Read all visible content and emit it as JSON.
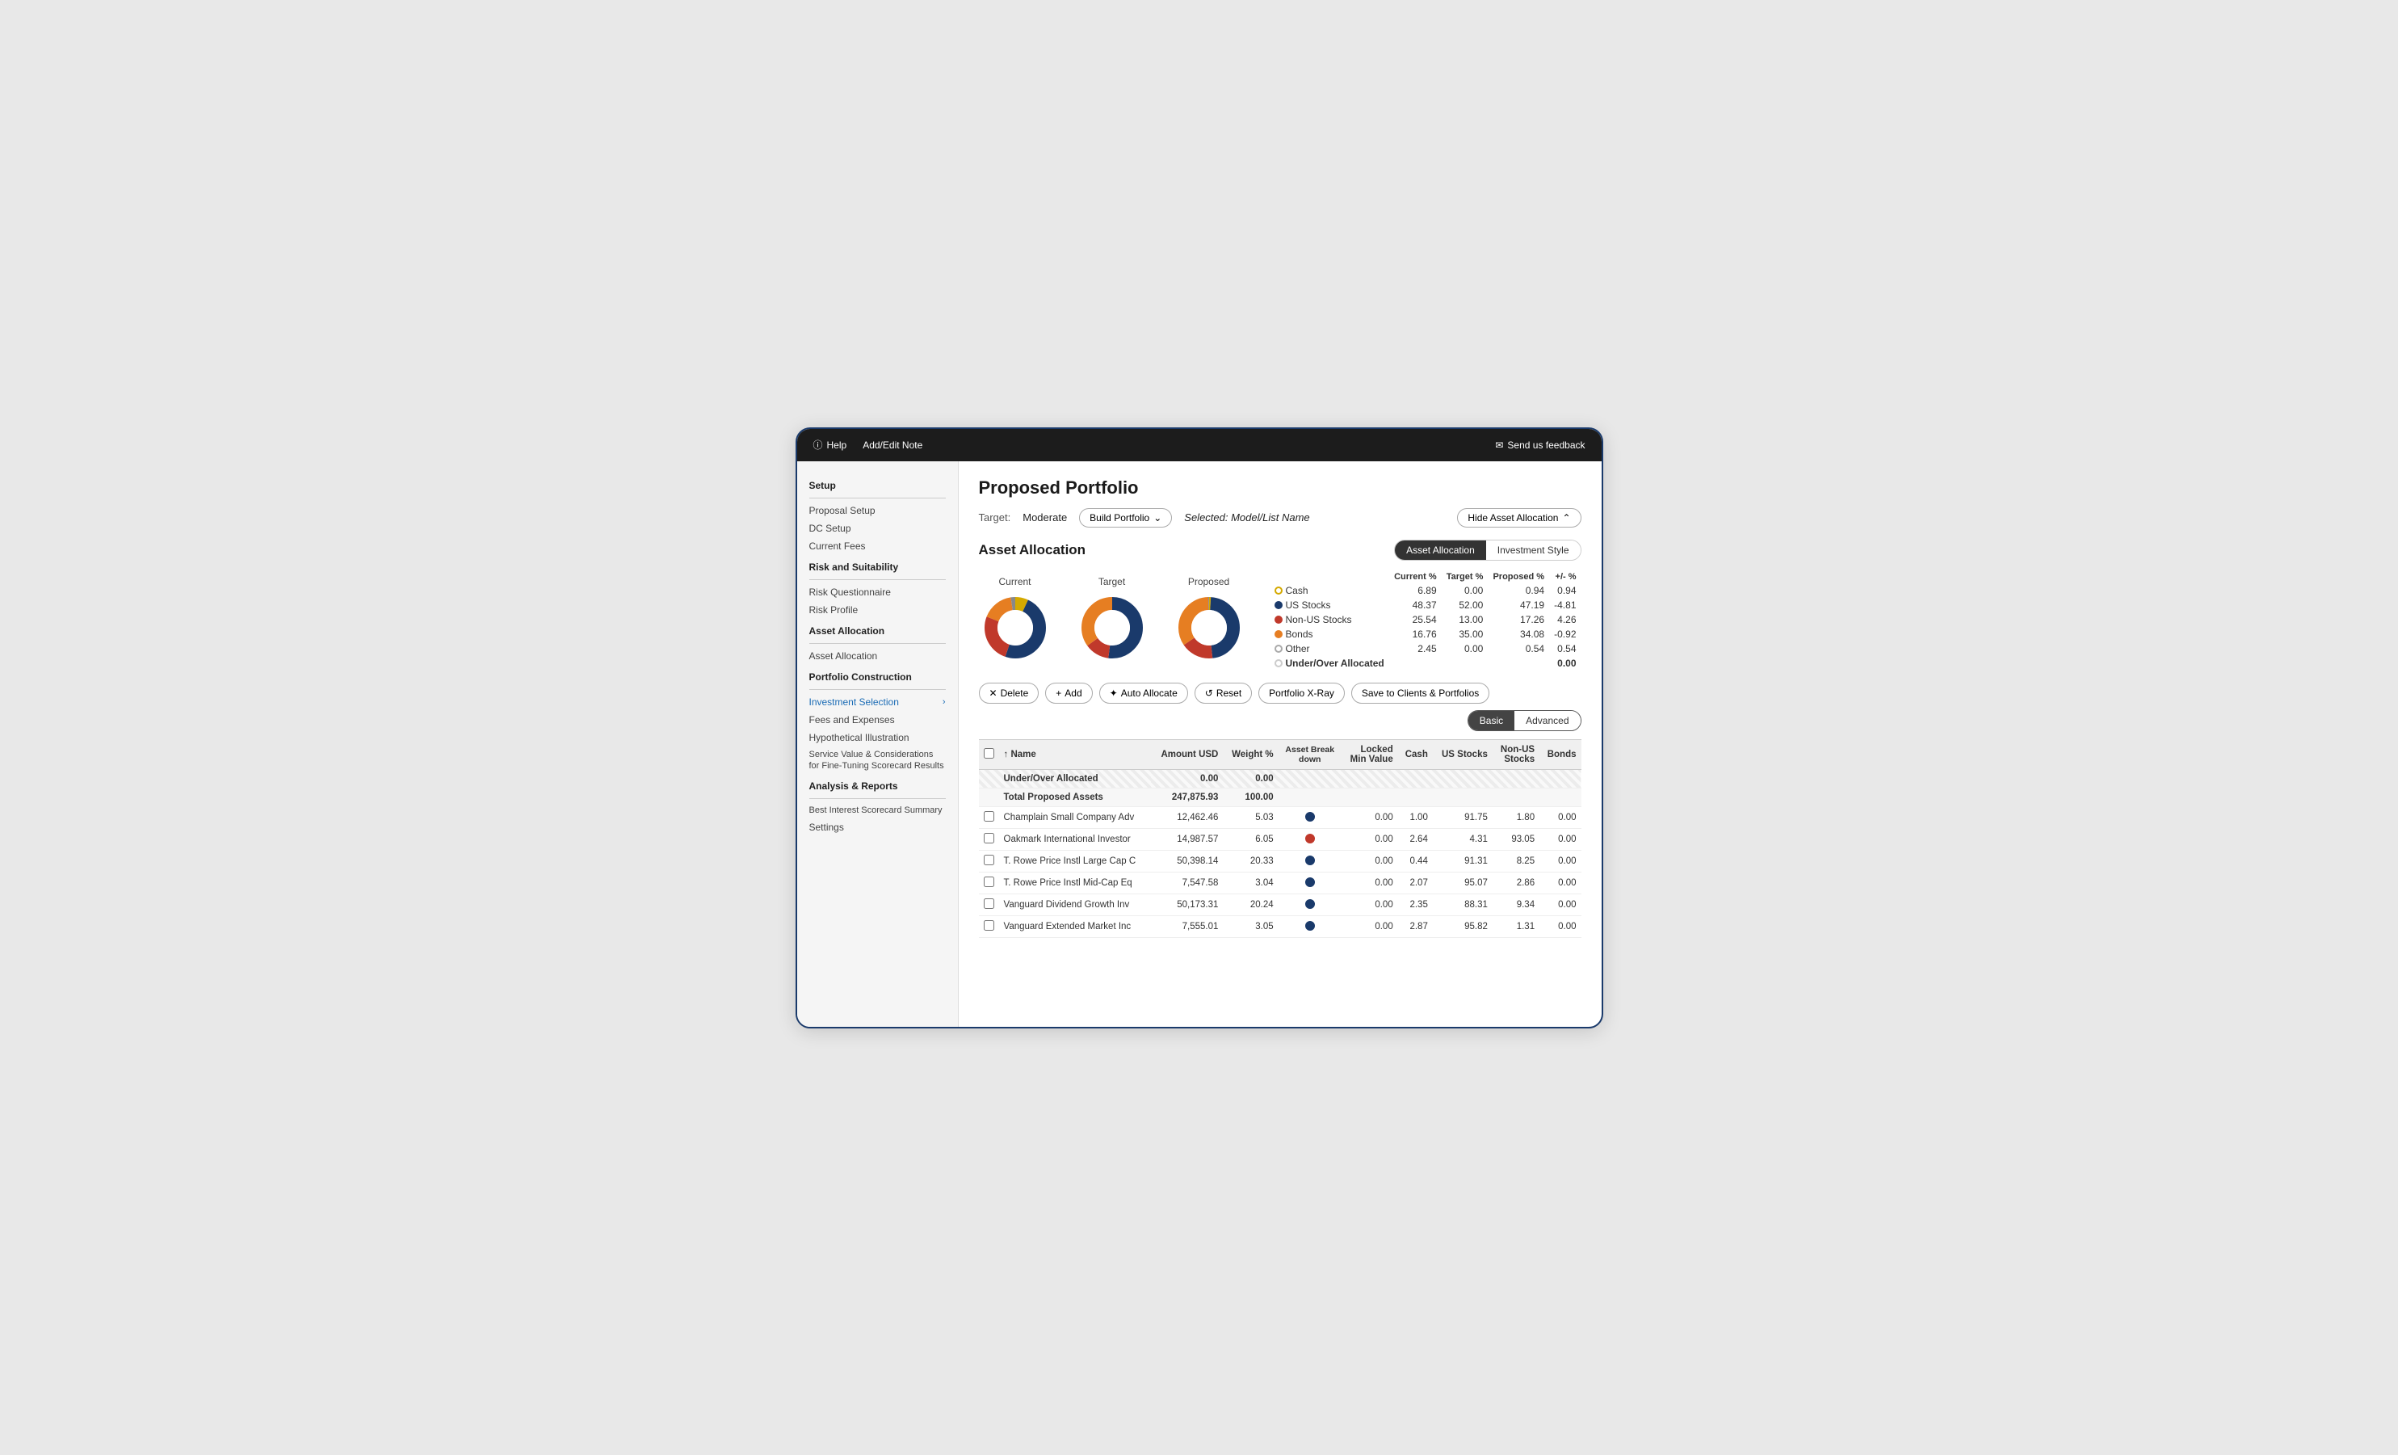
{
  "topbar": {
    "help_label": "Help",
    "add_edit_note_label": "Add/Edit Note",
    "feedback_label": "Send us feedback"
  },
  "sidebar": {
    "sections": [
      {
        "title": "Setup",
        "items": [
          {
            "label": "Proposal Setup",
            "active": false
          },
          {
            "label": "DC Setup",
            "active": false
          },
          {
            "label": "Current Fees",
            "active": false
          }
        ]
      },
      {
        "title": "Risk and Suitability",
        "items": [
          {
            "label": "Risk Questionnaire",
            "active": false
          },
          {
            "label": "Risk Profile",
            "active": false
          }
        ]
      },
      {
        "title": "Asset Allocation",
        "items": [
          {
            "label": "Asset Allocation",
            "active": false
          }
        ]
      },
      {
        "title": "Portfolio Construction",
        "items": [
          {
            "label": "Investment Selection",
            "active": true
          },
          {
            "label": "Fees and Expenses",
            "active": false
          },
          {
            "label": "Hypothetical Illustration",
            "active": false
          },
          {
            "label": "Service Value & Considerations for Fine-Tuning Scorecard Results",
            "active": false
          }
        ]
      },
      {
        "title": "Analysis & Reports",
        "items": [
          {
            "label": "Best Interest Scorecard Summary",
            "active": false
          },
          {
            "label": "Settings",
            "active": false
          }
        ]
      }
    ]
  },
  "content": {
    "page_title": "Proposed Portfolio",
    "target_label": "Target:",
    "target_value": "Moderate",
    "build_portfolio_btn": "Build Portfolio",
    "selected_label": "Selected: Model/List Name",
    "hide_asset_allocation_btn": "Hide Asset Allocation",
    "asset_allocation_section_title": "Asset Allocation",
    "tab_asset_allocation": "Asset Allocation",
    "tab_investment_style": "Investment Style",
    "chart_labels": [
      "Current",
      "Target",
      "Proposed"
    ],
    "legend": {
      "headers": [
        "",
        "Current %",
        "Target %",
        "Proposed %",
        "+/- %"
      ],
      "rows": [
        {
          "color": "#d4a900",
          "fill": false,
          "label": "Cash",
          "current": "6.89",
          "target": "0.00",
          "proposed": "0.94",
          "diff": "0.94"
        },
        {
          "color": "#1a3a6b",
          "fill": true,
          "label": "US Stocks",
          "current": "48.37",
          "target": "52.00",
          "proposed": "47.19",
          "diff": "-4.81"
        },
        {
          "color": "#c0392b",
          "fill": true,
          "label": "Non-US Stocks",
          "current": "25.54",
          "target": "13.00",
          "proposed": "17.26",
          "diff": "4.26"
        },
        {
          "color": "#e67e22",
          "fill": true,
          "label": "Bonds",
          "current": "16.76",
          "target": "35.00",
          "proposed": "34.08",
          "diff": "-0.92"
        },
        {
          "color": "#aaaaaa",
          "fill": false,
          "label": "Other",
          "current": "2.45",
          "target": "0.00",
          "proposed": "0.54",
          "diff": "0.54"
        },
        {
          "color": "#cccccc",
          "fill": false,
          "label": "Under/Over Allocated",
          "current": "",
          "target": "",
          "proposed": "",
          "diff": "0.00",
          "bold": true
        }
      ]
    },
    "toolbar": {
      "delete_btn": "Delete",
      "add_btn": "Add",
      "auto_allocate_btn": "Auto Allocate",
      "reset_btn": "Reset",
      "portfolio_xray_btn": "Portfolio X-Ray",
      "save_btn": "Save to Clients & Portfolios",
      "basic_btn": "Basic",
      "advanced_btn": "Advanced"
    },
    "table": {
      "headers": [
        "",
        "↑ Name",
        "Amount USD",
        "Weight %",
        "Asset Break down",
        "Locked Min Value",
        "Cash",
        "US Stocks",
        "Non-US Stocks",
        "Bonds"
      ],
      "summary_rows": [
        {
          "label": "Under/Over Allocated",
          "amount": "0.00",
          "weight": "0.00",
          "hatch": true
        },
        {
          "label": "Total Proposed Assets",
          "amount": "247,875.93",
          "weight": "100.00",
          "hatch": false
        }
      ],
      "rows": [
        {
          "name": "Champlain Small Company Adv",
          "amount": "12,462.46",
          "weight": "5.03",
          "icon_color": "#1a3a6b",
          "locked_min": "0.00",
          "cash": "1.00",
          "us_stocks": "91.75",
          "non_us_stocks": "1.80",
          "bonds": "0.00"
        },
        {
          "name": "Oakmark International Investor",
          "amount": "14,987.57",
          "weight": "6.05",
          "icon_color": "#c0392b",
          "locked_min": "0.00",
          "cash": "2.64",
          "us_stocks": "4.31",
          "non_us_stocks": "93.05",
          "bonds": "0.00"
        },
        {
          "name": "T. Rowe Price Instl Large Cap C",
          "amount": "50,398.14",
          "weight": "20.33",
          "icon_color": "#1a3a6b",
          "locked_min": "0.00",
          "cash": "0.44",
          "us_stocks": "91.31",
          "non_us_stocks": "8.25",
          "bonds": "0.00"
        },
        {
          "name": "T. Rowe Price Instl Mid-Cap Eq",
          "amount": "7,547.58",
          "weight": "3.04",
          "icon_color": "#1a3a6b",
          "locked_min": "0.00",
          "cash": "2.07",
          "us_stocks": "95.07",
          "non_us_stocks": "2.86",
          "bonds": "0.00"
        },
        {
          "name": "Vanguard Dividend Growth Inv",
          "amount": "50,173.31",
          "weight": "20.24",
          "icon_color": "#1a3a6b",
          "locked_min": "0.00",
          "cash": "2.35",
          "us_stocks": "88.31",
          "non_us_stocks": "9.34",
          "bonds": "0.00"
        },
        {
          "name": "Vanguard Extended Market Inc",
          "amount": "7,555.01",
          "weight": "3.05",
          "icon_color": "#1a3a6b",
          "locked_min": "0.00",
          "cash": "2.87",
          "us_stocks": "95.82",
          "non_us_stocks": "1.31",
          "bonds": "0.00"
        }
      ]
    }
  },
  "colors": {
    "cash": "#d4a900",
    "us_stocks": "#1a3a6b",
    "non_us_stocks": "#c0392b",
    "bonds": "#e67e22",
    "other": "#aaaaaa"
  }
}
